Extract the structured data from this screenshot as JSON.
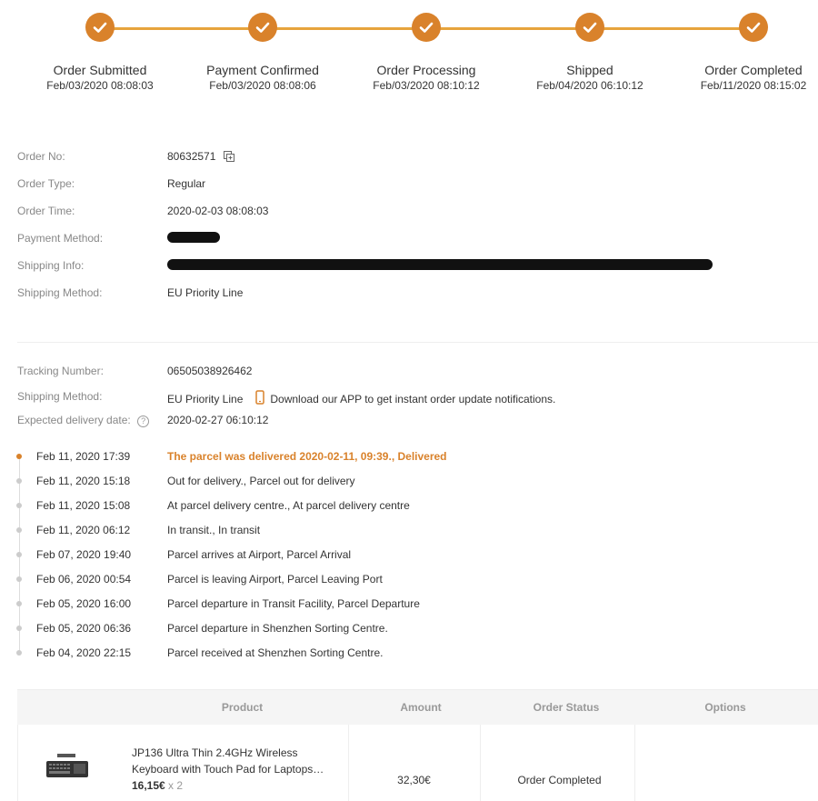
{
  "colors": {
    "accent": "#d9822b",
    "line": "#e7a43c",
    "label": "#888888"
  },
  "steps": [
    {
      "name": "Order Submitted",
      "time": "Feb/03/2020 08:08:03"
    },
    {
      "name": "Payment Confirmed",
      "time": "Feb/03/2020 08:08:06"
    },
    {
      "name": "Order Processing",
      "time": "Feb/03/2020 08:10:12"
    },
    {
      "name": "Shipped",
      "time": "Feb/04/2020 06:10:12"
    },
    {
      "name": "Order Completed",
      "time": "Feb/11/2020 08:15:02"
    }
  ],
  "order": {
    "no_label": "Order No:",
    "no": "80632571",
    "type_label": "Order Type:",
    "type": "Regular",
    "time_label": "Order Time:",
    "time": "2020-02-03 08:08:03",
    "payment_label": "Payment Method:",
    "shipping_info_label": "Shipping Info:",
    "shipping_method_label": "Shipping Method:",
    "shipping_method": "EU Priority Line"
  },
  "tracking": {
    "number_label": "Tracking Number:",
    "number": "06505038926462",
    "method_label": "Shipping Method:",
    "method": "EU Priority Line",
    "app_text": "Download our APP to get instant order update notifications.",
    "delivery_label": "Expected delivery date:",
    "delivery_date": "2020-02-27 06:10:12",
    "help_icon": "?"
  },
  "timeline": [
    {
      "date": "Feb 11, 2020 17:39",
      "text": "The parcel was delivered 2020-02-11, 09:39., Delivered",
      "active": true
    },
    {
      "date": "Feb 11, 2020 15:18",
      "text": "Out for delivery., Parcel out for delivery"
    },
    {
      "date": "Feb 11, 2020 15:08",
      "text": "At parcel delivery centre., At parcel delivery centre"
    },
    {
      "date": "Feb 11, 2020 06:12",
      "text": "In transit., In transit"
    },
    {
      "date": "Feb 07, 2020 19:40",
      "text": "Parcel arrives at Airport, Parcel Arrival"
    },
    {
      "date": "Feb 06, 2020 00:54",
      "text": "Parcel is leaving Airport, Parcel Leaving Port"
    },
    {
      "date": "Feb 05, 2020 16:00",
      "text": "Parcel departure in Transit Facility, Parcel Departure"
    },
    {
      "date": "Feb 05, 2020 06:36",
      "text": "Parcel departure in Shenzhen Sorting Centre."
    },
    {
      "date": "Feb 04, 2020 22:15",
      "text": "Parcel received at Shenzhen Sorting Centre."
    }
  ],
  "table": {
    "headers": {
      "product": "Product",
      "amount": "Amount",
      "status": "Order Status",
      "options": "Options"
    },
    "row": {
      "title_line1": "JP136 Ultra Thin 2.4GHz Wireless",
      "title_line2": "Keyboard with Touch Pad for Laptops…",
      "price": "16,15€",
      "qty": "x 2",
      "amount": "32,30€",
      "status": "Order Completed"
    }
  }
}
